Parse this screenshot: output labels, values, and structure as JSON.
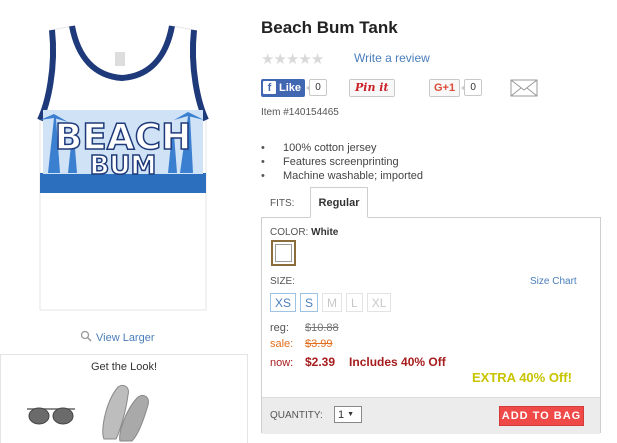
{
  "product": {
    "title": "Beach Bum Tank",
    "write_review": "Write a review",
    "item_number": "Item #140154465",
    "features": [
      "100% cotton jersey",
      "Features screenprinting",
      "Machine washable; imported"
    ],
    "rating_stars": 5
  },
  "image": {
    "view_larger": "View Larger",
    "shirt_text_line1": "BEACH",
    "shirt_text_line2": "BUM"
  },
  "get_the_look": {
    "title": "Get the Look!"
  },
  "social": {
    "fb_like_label": "Like",
    "fb_like_count": "0",
    "pinit_label": "Pin it",
    "gplus_label": "G+1",
    "gplus_count": "0"
  },
  "fits": {
    "label": "FITS:",
    "selected_tab": "Regular"
  },
  "color": {
    "label": "COLOR:",
    "value": "White"
  },
  "size": {
    "label": "SIZE:",
    "chart_link": "Size Chart",
    "options": [
      {
        "label": "XS",
        "available": true
      },
      {
        "label": "S",
        "available": true
      },
      {
        "label": "M",
        "available": false
      },
      {
        "label": "L",
        "available": false
      },
      {
        "label": "XL",
        "available": false
      }
    ]
  },
  "pricing": {
    "reg_label": "reg:",
    "reg_value": "$10.88",
    "sale_label": "sale:",
    "sale_value": "$3.99",
    "now_label": "now:",
    "now_value": "$2.39",
    "discount_note": "Includes 40% Off",
    "extra_off": "EXTRA 40% Off!"
  },
  "purchase": {
    "quantity_label": "QUANTITY:",
    "quantity_value": "1",
    "add_to_bag": "ADD TO BAG"
  },
  "colors": {
    "link": "#4a7ebb",
    "price_red": "#a61c1c",
    "sale_orange": "#e36f1e",
    "extra_yellow": "#c8c400",
    "add_to_bag": "#ef4a48",
    "facebook": "#4267b2"
  }
}
